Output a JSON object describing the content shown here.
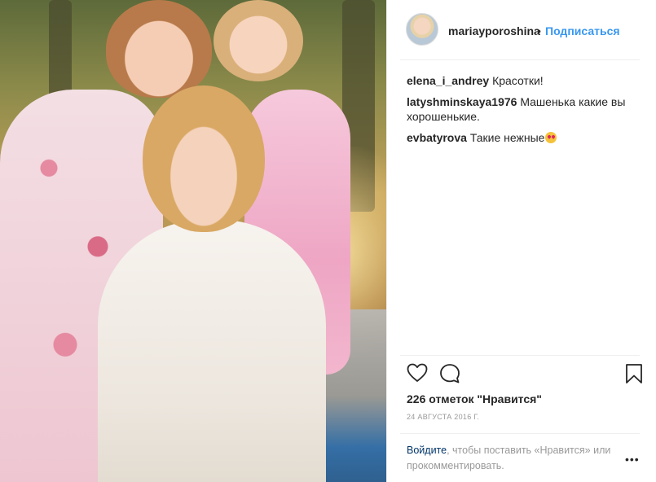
{
  "post": {
    "username": "mariayporoshina",
    "separator": "•",
    "follow_label": "Подписаться"
  },
  "comments": [
    {
      "user": "elena_i_andrey",
      "text": "Красотки!"
    },
    {
      "user": "latyshminskaya1976",
      "text": "Машенька какие вы хорошенькие."
    },
    {
      "user": "evbatyrova",
      "text": "Такие нежные"
    }
  ],
  "icons": {
    "like": "heart-icon",
    "comment": "comment-icon",
    "save": "bookmark-icon",
    "more": "more-options-icon"
  },
  "stats": {
    "likes": "226 отметок \"Нравится\"",
    "date": "24 АВГУСТА 2016 Г."
  },
  "login_prompt": {
    "link": "Войдите",
    "text": ", чтобы поставить «Нравится» или прокомментировать.",
    "more": "•••"
  },
  "colors": {
    "link": "#3897f0",
    "login_link": "#003569",
    "muted": "#999999",
    "text": "#262626"
  }
}
